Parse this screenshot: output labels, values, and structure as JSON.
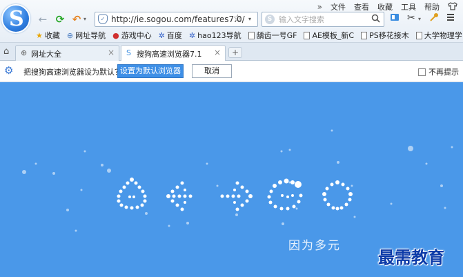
{
  "menu": {
    "chevron": "»",
    "items": [
      "文件",
      "查看",
      "收藏",
      "工具",
      "帮助"
    ],
    "shirt_icon": "shirt-icon"
  },
  "nav": {
    "back": "←",
    "refresh": "⟳",
    "undo": "↶",
    "undo_drop": "▾"
  },
  "address": {
    "url": "http://ie.sogou.com/features7.0/",
    "star": "☆",
    "drop": "▾"
  },
  "search": {
    "placeholder": "输入文字搜索",
    "badge": "S",
    "icon": "⌕"
  },
  "favorites": [
    "收藏",
    "网址导航",
    "游戏中心",
    "百度",
    "hao123导航",
    "龋齿一号GF",
    "AE模板_新C",
    "PS移花接木",
    "大学物理学"
  ],
  "tabs": [
    {
      "label": "网址大全",
      "active": false
    },
    {
      "label": "搜狗高速浏览器7.1",
      "active": true
    }
  ],
  "newtab": "+",
  "infobar": {
    "message": "把搜狗高速浏览器设为默认？",
    "set_default": "设置为默认浏览器",
    "cancel": "取消",
    "no_prompt": "不再提示"
  },
  "hero": {
    "slogan": "因为多元"
  },
  "watermark": "最需教育",
  "colors": {
    "hero_bg": "#4a98e9",
    "primary_button": "#3e8fe6",
    "watermark": "#0c3aa8"
  }
}
